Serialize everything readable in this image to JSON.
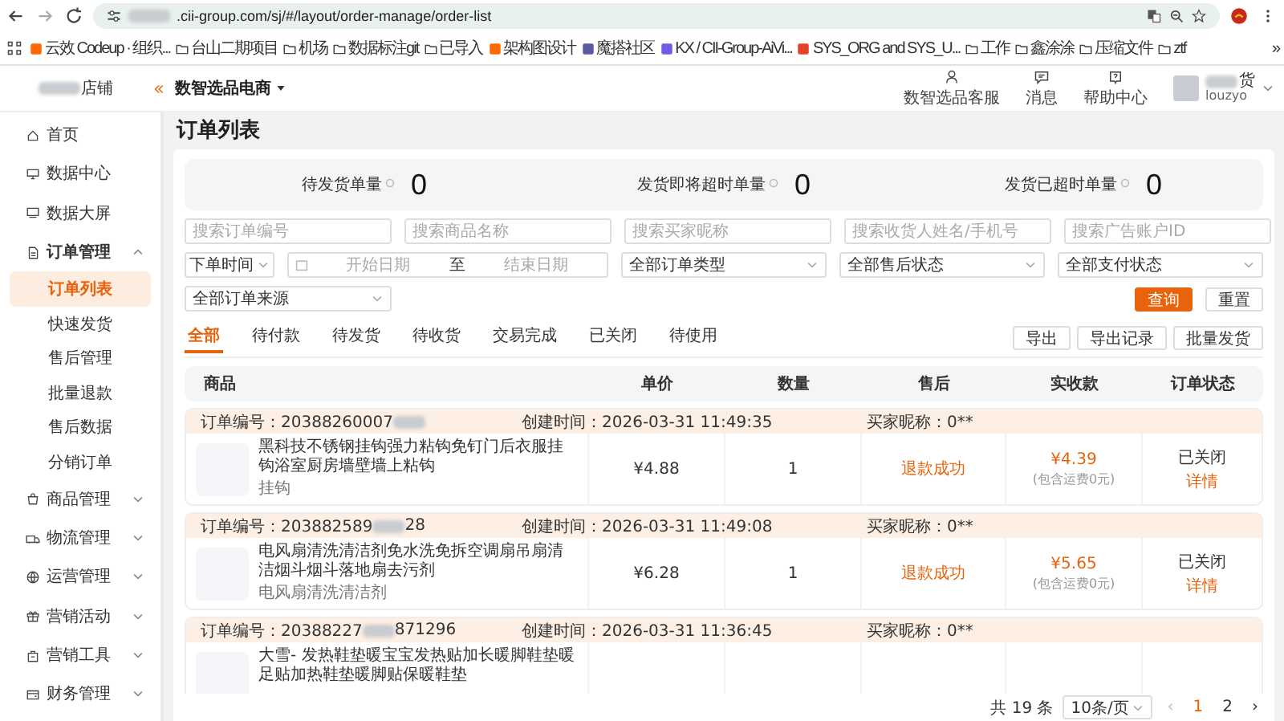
{
  "browser": {
    "url": ".cii-group.com/sj/#/layout/order-manage/order-list",
    "url_redacted": true,
    "bookmarks": [
      {
        "label": "云效 Codeup · 组织...",
        "kind": "site"
      },
      {
        "label": "台山二期项目",
        "kind": "folder"
      },
      {
        "label": "机场",
        "kind": "folder"
      },
      {
        "label": "数据标注git",
        "kind": "folder"
      },
      {
        "label": "已导入",
        "kind": "folder"
      },
      {
        "label": "架构图设计",
        "kind": "site"
      },
      {
        "label": "魔搭社区",
        "kind": "site"
      },
      {
        "label": "KX / CII-Group-AiVi...",
        "kind": "site"
      },
      {
        "label": "SYS_ORG and SYS_U...",
        "kind": "site"
      },
      {
        "label": "工作",
        "kind": "folder"
      },
      {
        "label": "鑫涂涂",
        "kind": "folder"
      },
      {
        "label": "压缩文件",
        "kind": "folder"
      },
      {
        "label": "ztf",
        "kind": "folder"
      }
    ],
    "more": "»"
  },
  "header": {
    "store": "店铺",
    "store_redacted": true,
    "switcher": "数智选品电商",
    "actions": [
      {
        "label": "数智选品客服"
      },
      {
        "label": "消息"
      },
      {
        "label": "帮助中心"
      }
    ],
    "user": {
      "name": "货",
      "name_redacted": true,
      "account": "louzyo"
    }
  },
  "sidebar": {
    "items": [
      {
        "label": "首页"
      },
      {
        "label": "数据中心"
      },
      {
        "label": "数据大屏"
      },
      {
        "label": "订单管理",
        "expanded": true,
        "children": [
          {
            "label": "订单列表",
            "selected": true
          },
          {
            "label": "快速发货",
            "selected": false
          },
          {
            "label": "售后管理",
            "selected": false
          },
          {
            "label": "批量退款",
            "selected": false
          },
          {
            "label": "售后数据",
            "selected": false
          },
          {
            "label": "分销订单",
            "selected": false
          }
        ]
      },
      {
        "label": "商品管理",
        "expanded": false
      },
      {
        "label": "物流管理",
        "expanded": false
      },
      {
        "label": "运营管理",
        "expanded": false
      },
      {
        "label": "营销活动",
        "expanded": false
      },
      {
        "label": "营销工具",
        "expanded": false
      },
      {
        "label": "财务管理",
        "expanded": false
      }
    ]
  },
  "page": {
    "title": "订单列表",
    "stats": [
      {
        "label": "待发货单量",
        "value": "0"
      },
      {
        "label": "发货即将超时单量",
        "value": "0"
      },
      {
        "label": "发货已超时单量",
        "value": "0"
      }
    ],
    "filters": [
      [
        {
          "kind": "input",
          "placeholder": "搜索订单编号"
        },
        {
          "kind": "input",
          "placeholder": "搜索商品名称"
        },
        {
          "kind": "input",
          "placeholder": "搜索买家昵称"
        },
        {
          "kind": "input",
          "placeholder": "搜索收货人姓名/手机号"
        },
        {
          "kind": "input",
          "placeholder": "搜索广告账户ID"
        }
      ],
      [
        {
          "kind": "select_small",
          "value": "下单时间"
        },
        {
          "kind": "daterange",
          "placeholder": "开始日期",
          "separator": "至",
          "placeholder_end": "结束日期"
        },
        {
          "kind": "select",
          "value": "全部订单类型"
        },
        {
          "kind": "select",
          "value": "全部售后状态"
        },
        {
          "kind": "select",
          "value": "全部支付状态"
        }
      ],
      [
        {
          "kind": "select",
          "value": "全部订单来源"
        }
      ]
    ],
    "search_button": "查询",
    "reset_button": "重置",
    "tabs": [
      {
        "label": "全部",
        "selected": true
      },
      {
        "label": "待付款",
        "selected": false
      },
      {
        "label": "待发货",
        "selected": false
      },
      {
        "label": "待收货",
        "selected": false
      },
      {
        "label": "交易完成",
        "selected": false
      },
      {
        "label": "已关闭",
        "selected": false
      },
      {
        "label": "待使用",
        "selected": false
      }
    ],
    "toolbar": [
      "导出",
      "导出记录",
      "批量发货"
    ],
    "table": {
      "columns": [
        "商品",
        "单价",
        "数量",
        "售后",
        "实收款",
        "订单状态"
      ],
      "orders": [
        {
          "order_no": "订单编号：20388260007",
          "redacted": true,
          "created": "创建时间：2026-03-31 11:49:35",
          "buyer": "买家昵称：0**",
          "title": "黑科技不锈钢挂钩强力粘钩免钉门后衣服挂钩浴室厨房墙壁墙上粘钩",
          "spec": "挂钩",
          "price": "¥4.88",
          "qty": "1",
          "after_sale": "退款成功",
          "paid": "¥4.39",
          "paid_note": "(包含运费0元)",
          "status": "已关闭",
          "detail": "详情"
        },
        {
          "order_no": "订单编号：203882589",
          "order_no_tail": "28",
          "redacted": true,
          "created": "创建时间：2026-03-31 11:49:08",
          "buyer": "买家昵称：0**",
          "title": "电风扇清洗清洁剂免水洗免拆空调扇吊扇清洁烟斗烟斗落地扇去污剂",
          "spec": "电风扇清洗清洁剂",
          "price": "¥6.28",
          "qty": "1",
          "after_sale": "退款成功",
          "paid": "¥5.65",
          "paid_note": "(包含运费0元)",
          "status": "已关闭",
          "detail": "详情"
        },
        {
          "order_no": "订单编号：20388227",
          "order_no_tail": "871296",
          "redacted": true,
          "created": "创建时间：2026-03-31 11:36:45",
          "buyer": "买家昵称：0**",
          "title": "大雪- 发热鞋垫暖宝宝发热贴加长暖脚鞋垫暖足贴加热鞋垫暖脚贴保暖鞋垫"
        }
      ]
    },
    "pagination": {
      "total": "共 19 条",
      "page_size": "10条/页",
      "prev": "‹",
      "pages": [
        {
          "label": "1",
          "selected": true
        },
        {
          "label": "2",
          "selected": false
        }
      ],
      "next": "›"
    }
  }
}
